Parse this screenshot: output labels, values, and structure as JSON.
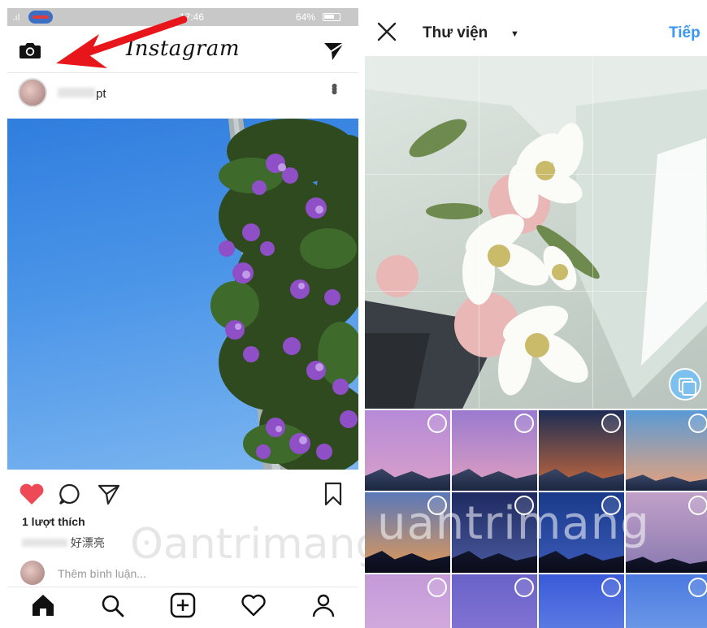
{
  "left": {
    "status": {
      "time": "17:46",
      "battery": "64%"
    },
    "topbar": {
      "logo": "Instagram"
    },
    "post": {
      "username": "pt",
      "likes": "1 lượt thích",
      "caption": "好漂亮",
      "comment_placeholder": "Thêm bình luận..."
    },
    "tabs": [
      "home-icon",
      "search-icon",
      "add-post-icon",
      "activity-heart-icon",
      "profile-icon"
    ]
  },
  "right": {
    "header": {
      "title": "Thư viện",
      "next": "Tiếp"
    },
    "thumbnails": [
      {
        "top": "#b58ad8",
        "bottom": "#d9a0c8"
      },
      {
        "top": "#9a7ad0",
        "bottom": "#e0a0c0"
      },
      {
        "top": "#1d2d55",
        "bottom": "#c96a3c"
      },
      {
        "top": "#5a9ad6",
        "bottom": "#e8a27a"
      },
      {
        "top": "#5a78b8",
        "bottom": "#e39a56"
      },
      {
        "top": "#1e2a60",
        "bottom": "#4a5aa0"
      },
      {
        "top": "#1a3a8a",
        "bottom": "#3a5ab8"
      },
      {
        "top": "#c0a0c8",
        "bottom": "#8a7ab0"
      },
      {
        "top": "#c49ad8",
        "bottom": "#d8b0e0"
      },
      {
        "top": "#6a62c8",
        "bottom": "#8a7ad8"
      },
      {
        "top": "#3a5ad8",
        "bottom": "#6a8ae8"
      },
      {
        "top": "#4a7ae0",
        "bottom": "#7aa4ea"
      }
    ]
  },
  "watermark": "uantrimang",
  "colors": {
    "accent": "#3897f0",
    "like": "#ed4956",
    "arrow": "#e8161b"
  }
}
